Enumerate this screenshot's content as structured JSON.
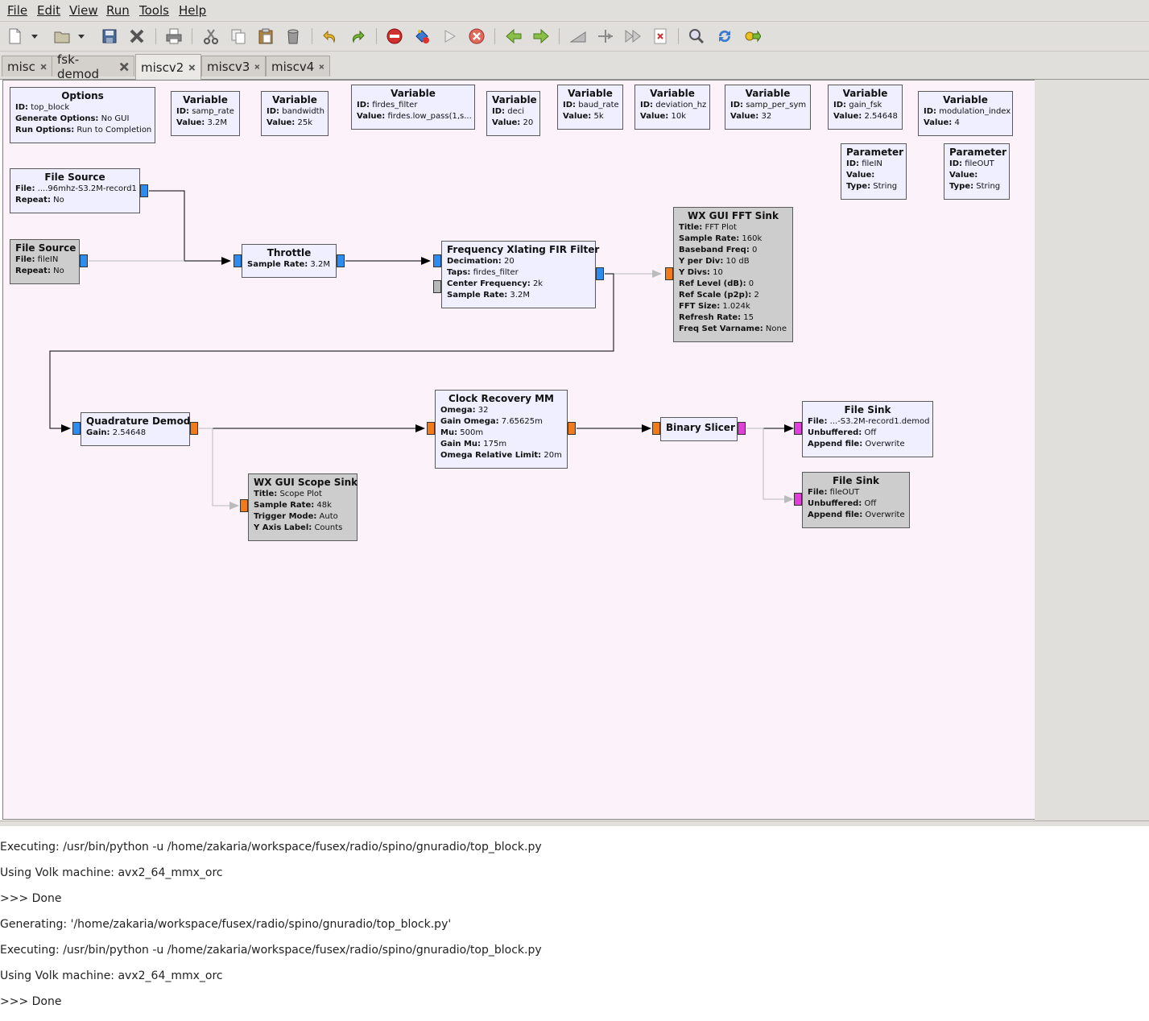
{
  "menu": [
    "File",
    "Edit",
    "View",
    "Run",
    "Tools",
    "Help"
  ],
  "tabs": [
    {
      "label": "misc",
      "active": false
    },
    {
      "label": "fsk-demod",
      "active": false
    },
    {
      "label": "miscv2",
      "active": true
    },
    {
      "label": "miscv3",
      "active": false
    },
    {
      "label": "miscv4",
      "active": false
    }
  ],
  "blocks": {
    "options": {
      "title": "Options",
      "props": [
        [
          "ID:",
          "top_block"
        ],
        [
          "Generate Options:",
          "No GUI"
        ],
        [
          "Run Options:",
          "Run to Completion"
        ]
      ]
    },
    "var_samp_rate": {
      "title": "Variable",
      "props": [
        [
          "ID:",
          "samp_rate"
        ],
        [
          "Value:",
          "3.2M"
        ]
      ]
    },
    "var_bandwidth": {
      "title": "Variable",
      "props": [
        [
          "ID:",
          "bandwidth"
        ],
        [
          "Value:",
          "25k"
        ]
      ]
    },
    "var_firdes": {
      "title": "Variable",
      "props": [
        [
          "ID:",
          "firdes_filter"
        ],
        [
          "Value:",
          "firdes.low_pass(1,s..."
        ]
      ]
    },
    "var_deci": {
      "title": "Variable",
      "props": [
        [
          "ID:",
          "deci"
        ],
        [
          "Value:",
          "20"
        ]
      ]
    },
    "var_baud": {
      "title": "Variable",
      "props": [
        [
          "ID:",
          "baud_rate"
        ],
        [
          "Value:",
          "5k"
        ]
      ]
    },
    "var_dev": {
      "title": "Variable",
      "props": [
        [
          "ID:",
          "deviation_hz"
        ],
        [
          "Value:",
          "10k"
        ]
      ]
    },
    "var_sps": {
      "title": "Variable",
      "props": [
        [
          "ID:",
          "samp_per_sym"
        ],
        [
          "Value:",
          "32"
        ]
      ]
    },
    "var_gain": {
      "title": "Variable",
      "props": [
        [
          "ID:",
          "gain_fsk"
        ],
        [
          "Value:",
          "2.54648"
        ]
      ]
    },
    "var_modidx": {
      "title": "Variable",
      "props": [
        [
          "ID:",
          "modulation_index"
        ],
        [
          "Value:",
          "4"
        ]
      ]
    },
    "param_in": {
      "title": "Parameter",
      "props": [
        [
          "ID:",
          "fileIN"
        ],
        [
          "Value:",
          ""
        ],
        [
          "Type:",
          "String"
        ]
      ]
    },
    "param_out": {
      "title": "Parameter",
      "props": [
        [
          "ID:",
          "fileOUT"
        ],
        [
          "Value:",
          ""
        ],
        [
          "Type:",
          "String"
        ]
      ]
    },
    "file_source_1": {
      "title": "File Source",
      "props": [
        [
          "File:",
          "....96mhz-S3.2M-record1"
        ],
        [
          "Repeat:",
          "No"
        ]
      ]
    },
    "file_source_2": {
      "title": "File Source",
      "props": [
        [
          "File:",
          "fileIN"
        ],
        [
          "Repeat:",
          "No"
        ]
      ]
    },
    "throttle": {
      "title": "Throttle",
      "props": [
        [
          "Sample Rate:",
          "3.2M"
        ]
      ]
    },
    "xlating": {
      "title": "Frequency Xlating FIR Filter",
      "props": [
        [
          "Decimation:",
          "20"
        ],
        [
          "Taps:",
          "firdes_filter"
        ],
        [
          "Center Frequency:",
          "2k"
        ],
        [
          "Sample Rate:",
          "3.2M"
        ]
      ]
    },
    "fft_sink": {
      "title": "WX GUI FFT Sink",
      "props": [
        [
          "Title:",
          "FFT Plot"
        ],
        [
          "Sample Rate:",
          "160k"
        ],
        [
          "Baseband Freq:",
          "0"
        ],
        [
          "Y per Div:",
          "10 dB"
        ],
        [
          "Y Divs:",
          "10"
        ],
        [
          "Ref Level (dB):",
          "0"
        ],
        [
          "Ref Scale (p2p):",
          "2"
        ],
        [
          "FFT Size:",
          "1.024k"
        ],
        [
          "Refresh Rate:",
          "15"
        ],
        [
          "Freq Set Varname:",
          "None"
        ]
      ]
    },
    "quad_demod": {
      "title": "Quadrature Demod",
      "props": [
        [
          "Gain:",
          "2.54648"
        ]
      ]
    },
    "clock_recovery": {
      "title": "Clock Recovery MM",
      "props": [
        [
          "Omega:",
          "32"
        ],
        [
          "Gain Omega:",
          "7.65625m"
        ],
        [
          "Mu:",
          "500m"
        ],
        [
          "Gain Mu:",
          "175m"
        ],
        [
          "Omega Relative Limit:",
          "20m"
        ]
      ]
    },
    "binary_slicer": {
      "title": "Binary Slicer",
      "props": []
    },
    "file_sink_1": {
      "title": "File Sink",
      "props": [
        [
          "File:",
          "...-S3.2M-record1.demod"
        ],
        [
          "Unbuffered:",
          "Off"
        ],
        [
          "Append file:",
          "Overwrite"
        ]
      ]
    },
    "file_sink_2": {
      "title": "File Sink",
      "props": [
        [
          "File:",
          "fileOUT"
        ],
        [
          "Unbuffered:",
          "Off"
        ],
        [
          "Append file:",
          "Overwrite"
        ]
      ]
    },
    "scope_sink": {
      "title": "WX GUI Scope Sink",
      "props": [
        [
          "Title:",
          "Scope Plot"
        ],
        [
          "Sample Rate:",
          "48k"
        ],
        [
          "Trigger Mode:",
          "Auto"
        ],
        [
          "Y Axis Label:",
          "Counts"
        ]
      ]
    }
  },
  "console": {
    "lines": [
      "Executing: /usr/bin/python -u /home/zakaria/workspace/fusex/radio/spino/gnuradio/top_block.py",
      "Using Volk machine: avx2_64_mmx_orc",
      ">>> Done",
      "Generating: '/home/zakaria/workspace/fusex/radio/spino/gnuradio/top_block.py'",
      "Executing: /usr/bin/python -u /home/zakaria/workspace/fusex/radio/spino/gnuradio/top_block.py",
      "Using Volk machine: avx2_64_mmx_orc",
      ">>> Done"
    ]
  }
}
